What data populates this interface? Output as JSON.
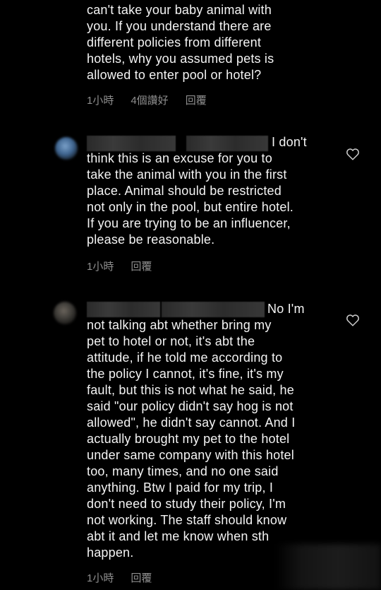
{
  "comments": [
    {
      "text": "can't take your baby animal with\nyou. If you understand there are\ndifferent policies from different\nhotels, why you assumed pets is\nallowed to enter pool or hotel?",
      "time": "1小時",
      "likes": "4個讚好",
      "reply": "回覆"
    },
    {
      "text": "I don't\nthink this is an excuse for you to\ntake the animal with you in the first\nplace. Animal should be restricted\nnot only in the pool, but entire hotel.\nIf you are trying to be an influencer,\nplease be reasonable.",
      "time": "1小時",
      "reply": "回覆"
    },
    {
      "text": "No I'm\nnot talking abt whether bring my\npet to hotel or not, it's abt the\nattitude, if he told me according to\nthe policy I cannot, it's fine, it's my\nfault, but this is not what he said, he\nsaid \"our policy didn't say hog is not\nallowed\", he didn't say cannot. And I\nactually brought my pet to the hotel\nunder same company with this hotel\ntoo, many times, and no one said\nanything. Btw I paid for my trip, I\ndon't need to study their policy, I'm\nnot working. The staff should know\nabt it and let me know when sth\nhappen.",
      "time": "1小時",
      "reply": "回覆"
    }
  ],
  "icons": {
    "like": "heart-outline-icon"
  }
}
